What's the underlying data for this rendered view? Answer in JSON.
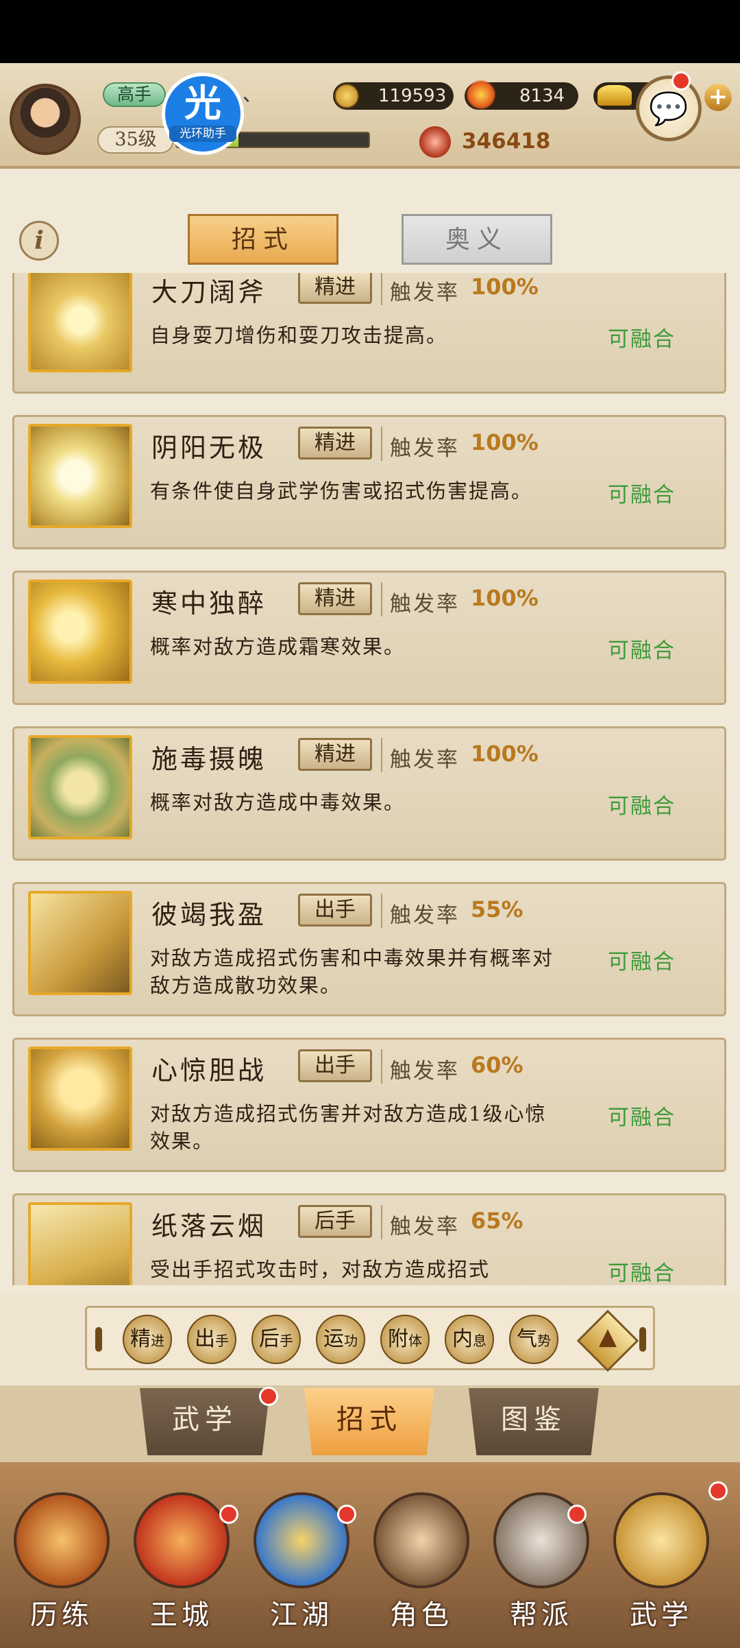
{
  "header": {
    "rank": "高手",
    "name": "、、",
    "level": "35级",
    "xp_fraction": 0.32,
    "helper_badge": {
      "char": "光",
      "label": "光环助手"
    },
    "silver": "119593",
    "gold": "8134",
    "power": "346418",
    "chat_icon": "chat-bubble-icon"
  },
  "tabs_top": {
    "active": "招式",
    "inactive": "奥义"
  },
  "skills": [
    {
      "name": "大刀阔斧",
      "tag": "精进",
      "rate_label": "触发率",
      "rate": "100%",
      "desc": "自身耍刀增伤和耍刀攻击提高。",
      "status": "可融合",
      "icon": "blade-fighter-icon"
    },
    {
      "name": "阴阳无极",
      "tag": "精进",
      "rate_label": "触发率",
      "rate": "100%",
      "desc": "有条件使自身武学伤害或招式伤害提高。",
      "status": "可融合",
      "icon": "glowing-orb-icon"
    },
    {
      "name": "寒中独醉",
      "tag": "精进",
      "rate_label": "触发率",
      "rate": "100%",
      "desc": "概率对敌方造成霜寒效果。",
      "status": "可融合",
      "icon": "drinker-icon"
    },
    {
      "name": "施毒摄魄",
      "tag": "精进",
      "rate_label": "触发率",
      "rate": "100%",
      "desc": "概率对敌方造成中毒效果。",
      "status": "可融合",
      "icon": "poison-hand-icon"
    },
    {
      "name": "彼竭我盈",
      "tag": "出手",
      "rate_label": "触发率",
      "rate": "55%",
      "desc": "对敌方造成招式伤害和中毒效果并有概率对敌方造成散功效果。",
      "status": "可融合",
      "icon": "duel-icon"
    },
    {
      "name": "心惊胆战",
      "tag": "出手",
      "rate_label": "触发率",
      "rate": "60%",
      "desc": "对敌方造成招式伤害并对敌方造成1级心惊效果。",
      "status": "可融合",
      "icon": "slash-fighter-icon"
    },
    {
      "name": "纸落云烟",
      "tag": "后手",
      "rate_label": "触发率",
      "rate": "65%",
      "desc": "受出手招式攻击时，对敌方造成招式",
      "status": "可融合",
      "icon": "leaping-fighter-icon"
    }
  ],
  "filters": [
    {
      "main": "精",
      "sub": "进"
    },
    {
      "main": "出",
      "sub": "手"
    },
    {
      "main": "后",
      "sub": "手"
    },
    {
      "main": "运",
      "sub": "功"
    },
    {
      "main": "附",
      "sub": "体"
    },
    {
      "main": "内",
      "sub": "息"
    },
    {
      "main": "气",
      "sub": "势"
    }
  ],
  "bottom_tabs": [
    "武学",
    "招式",
    "图鉴"
  ],
  "nav": [
    "历练",
    "王城",
    "江湖",
    "角色",
    "帮派",
    "武学"
  ],
  "colors": {
    "accent": "#e8a94f",
    "fuse_green": "#3e9b3a",
    "rate_gold": "#b9791e",
    "badge_red": "#e4392a"
  }
}
